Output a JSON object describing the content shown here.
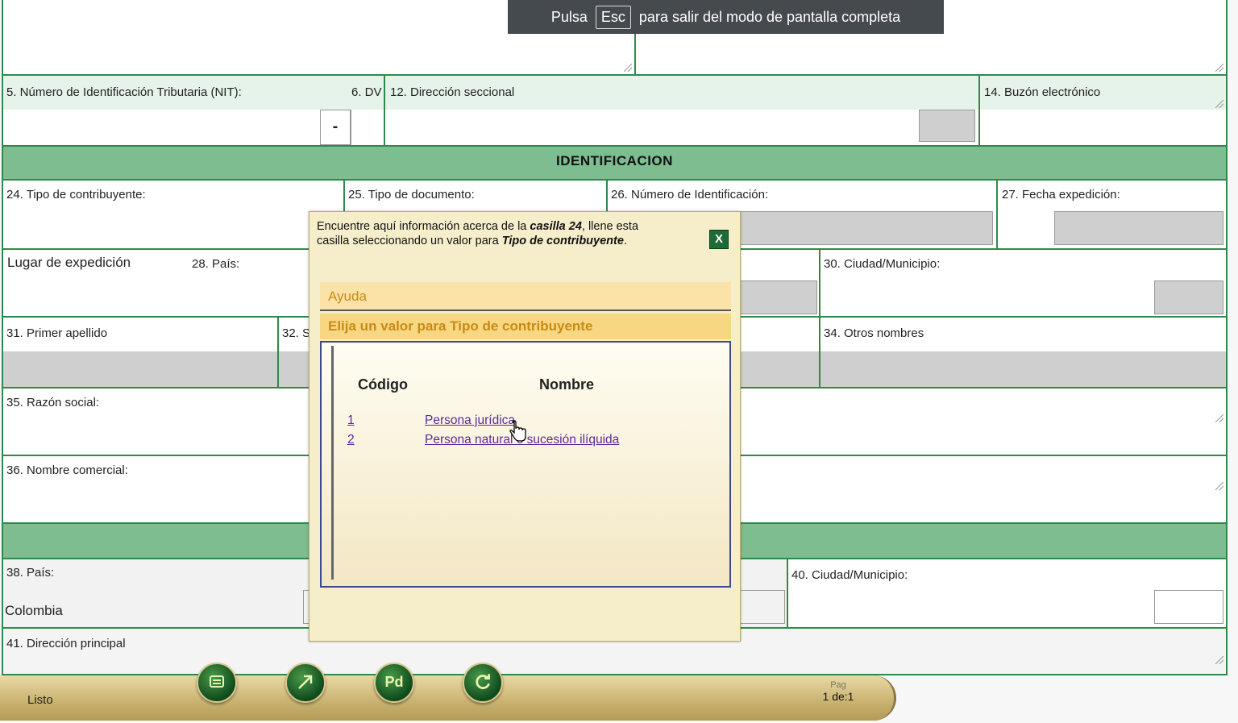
{
  "fullscreen_banner": {
    "prefix": "Pulsa",
    "key": "Esc",
    "suffix": "para salir del modo de pantalla completa"
  },
  "form": {
    "f5_label": "5. Número de Identificación Tributaria (NIT):",
    "f6_label": "6. DV",
    "dash": "-",
    "f12_label": "12. Dirección seccional",
    "f14_label": "14. Buzón electrónico",
    "section_identificacion": "IDENTIFICACION",
    "f24_label": "24. Tipo de contribuyente:",
    "f25_label": "25. Tipo de documento:",
    "f26_label": "26. Número de Identificación:",
    "f27_label": "27. Fecha expedición:",
    "lugar_label": "Lugar de expedición",
    "f28_label": "28. País:",
    "f30_label": "30. Ciudad/Municipio:",
    "f31_label": "31. Primer apellido",
    "f32_label": "32. S",
    "f34_label": "34. Otros nombres",
    "f35_label": "35. Razón social:",
    "f36_label": "36. Nombre comercial:",
    "f38_label": "38. País:",
    "f38_value": "Colombia",
    "f40_label": "40. Ciudad/Municipio:",
    "f41_label": "41. Dirección principal"
  },
  "popup": {
    "msg_part1": "Encuentre aquí información acerca de la ",
    "msg_bold1": "casilla 24",
    "msg_part2": ", llene esta casilla seleccionando un valor para ",
    "msg_bold2": "Tipo de contribuyente",
    "msg_part3": ".",
    "close_label": "X",
    "ayuda": "Ayuda",
    "elija": "Elija un valor para Tipo de contribuyente",
    "col_codigo": "Código",
    "col_nombre": "Nombre",
    "options": [
      {
        "code": "1",
        "name": "Persona jurídica"
      },
      {
        "code": "2",
        "name": "Persona natural o sucesión ilíquida"
      }
    ]
  },
  "toolbar": {
    "status": "Listo",
    "buttons": [
      "document-icon",
      "arrow-icon",
      "pdf-icon",
      "refresh-icon"
    ],
    "pdf_glyph": "Pd",
    "pag_label": "Pag",
    "pag_value": "1 de:1"
  }
}
